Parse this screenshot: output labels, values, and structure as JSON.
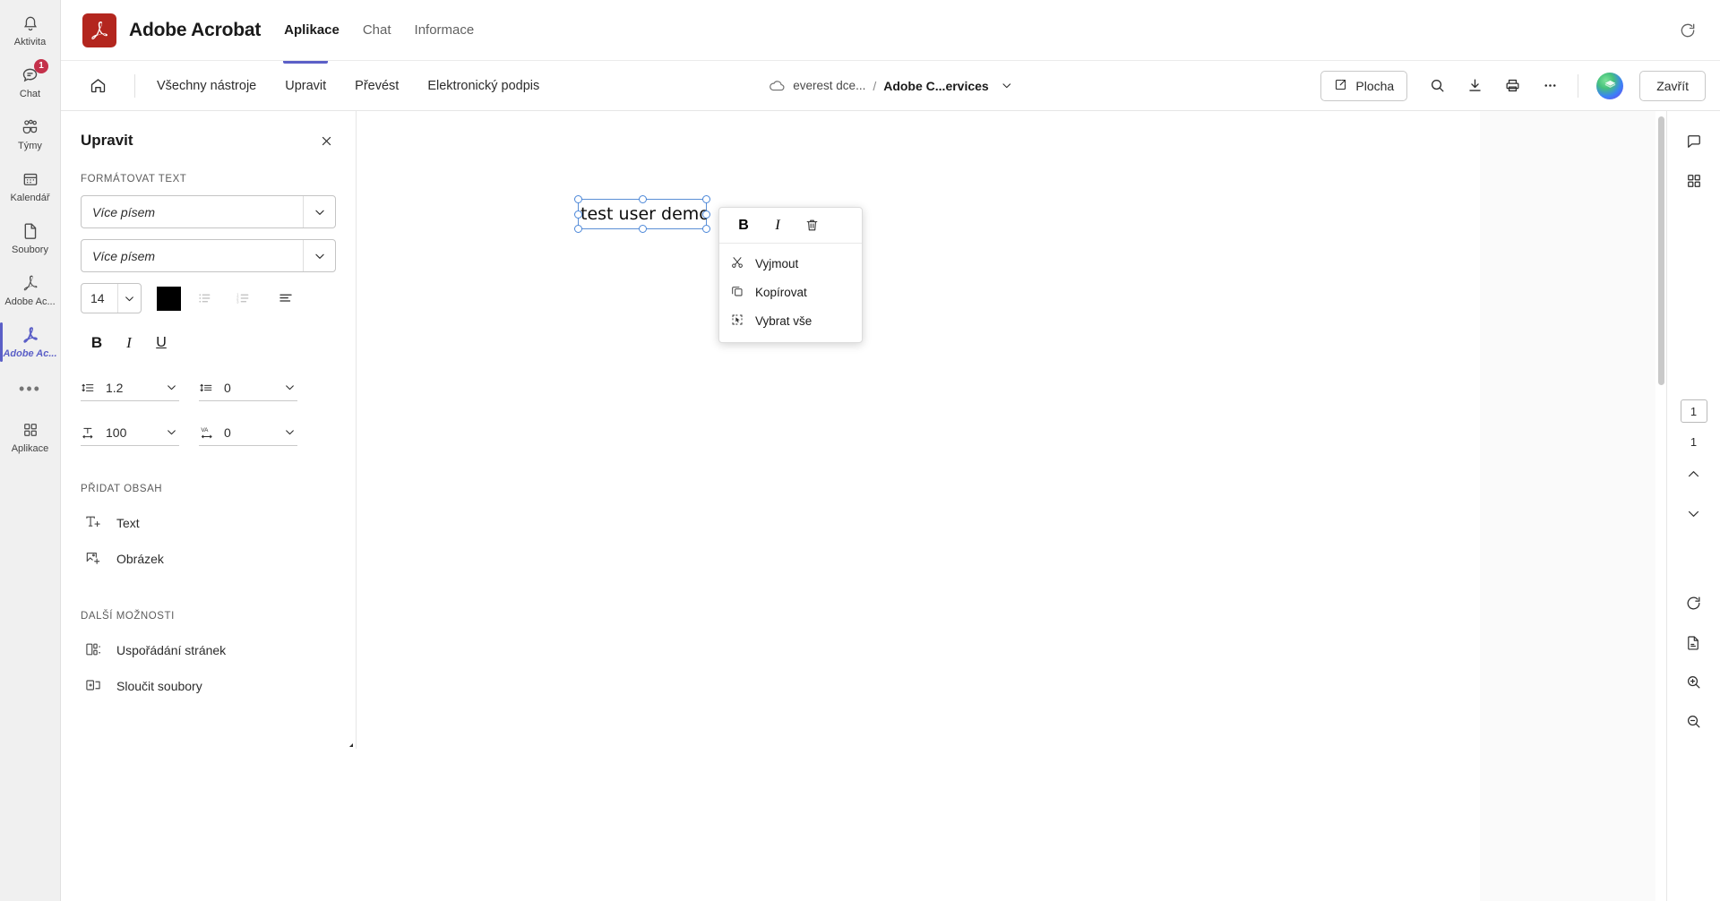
{
  "rail": {
    "items": [
      {
        "label": "Aktivita",
        "icon": "bell-icon",
        "badge": null,
        "active": false
      },
      {
        "label": "Chat",
        "icon": "chat-icon",
        "badge": "1",
        "active": false
      },
      {
        "label": "Týmy",
        "icon": "teams-icon",
        "badge": null,
        "active": false
      },
      {
        "label": "Kalendář",
        "icon": "calendar-icon",
        "badge": null,
        "active": false
      },
      {
        "label": "Soubory",
        "icon": "files-icon",
        "badge": null,
        "active": false
      },
      {
        "label": "Adobe Ac...",
        "icon": "acrobat-icon",
        "badge": null,
        "active": false
      },
      {
        "label": "Adobe Ac...",
        "icon": "acrobat-icon",
        "badge": null,
        "active": true
      }
    ],
    "more_label": "•••",
    "apps": {
      "label": "Aplikace",
      "icon": "apps-grid-icon"
    }
  },
  "appbar": {
    "logo_alt": "acrobat-logo",
    "title": "Adobe Acrobat",
    "tabs": [
      {
        "label": "Aplikace",
        "active": true
      },
      {
        "label": "Chat",
        "active": false
      },
      {
        "label": "Informace",
        "active": false
      }
    ],
    "refresh_icon": "refresh-icon"
  },
  "toolbar": {
    "home_icon": "home-icon",
    "tabs": [
      {
        "label": "Všechny nástroje",
        "active": false
      },
      {
        "label": "Upravit",
        "active": true
      },
      {
        "label": "Převést",
        "active": false
      },
      {
        "label": "Elektronický podpis",
        "active": false
      }
    ],
    "breadcrumb": {
      "cloud_icon": "cloud-icon",
      "folder": "everest dce...",
      "separator": "/",
      "file": "Adobe C...ervices",
      "caret_icon": "chevron-down-icon"
    },
    "desktop_button": {
      "label": "Plocha",
      "icon": "open-external-icon"
    },
    "icons": [
      {
        "name": "search-icon"
      },
      {
        "name": "download-icon"
      },
      {
        "name": "print-icon"
      },
      {
        "name": "more-horizontal-icon"
      }
    ],
    "avatar_name": "user-avatar",
    "close_label": "Zavřít"
  },
  "edit_panel": {
    "title": "Upravit",
    "close_icon": "close-icon",
    "section_format": "FORMÁTOVAT TEXT",
    "font_family": "Více písem",
    "font_style": "Více písem",
    "font_size": "14",
    "text_color": "#000000",
    "bullet_list_icon": "bulleted-list-icon",
    "number_list_icon": "numbered-list-icon",
    "align_icon": "align-left-icon",
    "bold_label": "B",
    "italic_label": "I",
    "underline_label": "U",
    "line_spacing_icon": "line-spacing-icon",
    "line_spacing": "1.2",
    "para_spacing_icon": "paragraph-spacing-icon",
    "para_spacing": "0",
    "horizontal_scale_icon": "horizontal-scale-icon",
    "horizontal_scale": "100",
    "tracking_icon": "VA",
    "tracking": "0",
    "section_add": "PŘIDAT OBSAH",
    "add_items": [
      {
        "label": "Text",
        "icon": "add-text-icon"
      },
      {
        "label": "Obrázek",
        "icon": "add-image-icon"
      }
    ],
    "section_more": "DALŠÍ MOŽNOSTI",
    "more_items": [
      {
        "label": "Uspořádání stránek",
        "icon": "organize-pages-icon"
      },
      {
        "label": "Sloučit soubory",
        "icon": "combine-files-icon"
      }
    ]
  },
  "tool_strip": {
    "buttons": [
      {
        "name": "select-tool",
        "active": true
      },
      {
        "name": "comment-tool",
        "active": false
      },
      {
        "name": "highlight-tool",
        "active": false
      },
      {
        "name": "draw-oval-tool",
        "active": false
      },
      {
        "name": "edit-text-tool",
        "active": false
      },
      {
        "name": "redact-tool",
        "active": false
      }
    ]
  },
  "canvas": {
    "textbox_value": "test user demo"
  },
  "context_menu": {
    "bold_label": "B",
    "italic_label": "I",
    "delete_icon": "trash-icon",
    "items": [
      {
        "label": "Vyjmout",
        "icon": "cut-icon"
      },
      {
        "label": "Kopírovat",
        "icon": "copy-icon"
      },
      {
        "label": "Vybrat vše",
        "icon": "select-all-icon"
      }
    ]
  },
  "right_rail": {
    "top_icons": [
      {
        "name": "comment-panel-icon"
      },
      {
        "name": "thumbnails-panel-icon"
      }
    ],
    "current_page": "1",
    "total_pages": "1",
    "nav_up_icon": "chevron-up-icon",
    "nav_down_icon": "chevron-down-icon",
    "bottom_icons": [
      {
        "name": "rotate-icon"
      },
      {
        "name": "page-fit-icon"
      },
      {
        "name": "zoom-in-icon"
      },
      {
        "name": "zoom-out-icon"
      }
    ]
  }
}
